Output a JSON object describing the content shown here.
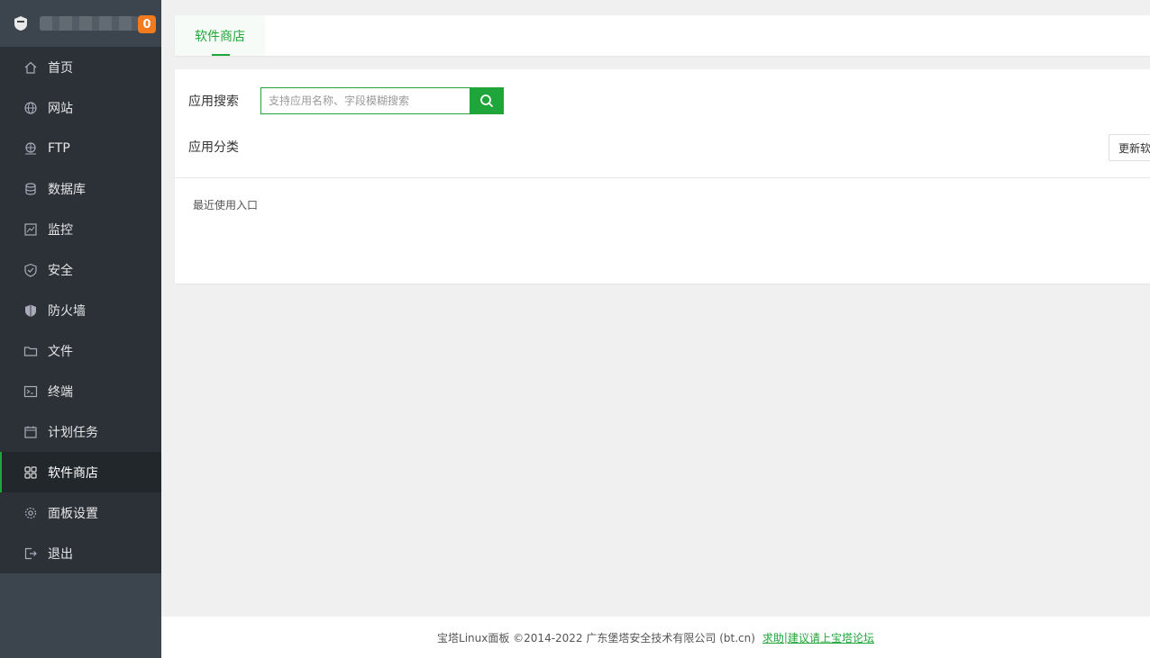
{
  "brand": {
    "badge_count": "0"
  },
  "sidebar": {
    "items": [
      {
        "label": "首页",
        "icon": "home-icon"
      },
      {
        "label": "网站",
        "icon": "globe-icon"
      },
      {
        "label": "FTP",
        "icon": "ftp-icon"
      },
      {
        "label": "数据库",
        "icon": "database-icon"
      },
      {
        "label": "监控",
        "icon": "monitor-icon"
      },
      {
        "label": "安全",
        "icon": "shield-check-icon"
      },
      {
        "label": "防火墙",
        "icon": "firewall-icon"
      },
      {
        "label": "文件",
        "icon": "folder-icon"
      },
      {
        "label": "终端",
        "icon": "terminal-icon"
      },
      {
        "label": "计划任务",
        "icon": "calendar-icon"
      },
      {
        "label": "软件商店",
        "icon": "grid-icon",
        "active": true
      },
      {
        "label": "面板设置",
        "icon": "gear-icon"
      },
      {
        "label": "退出",
        "icon": "logout-icon"
      }
    ]
  },
  "tabs": [
    {
      "label": "软件商店",
      "active": true
    }
  ],
  "search": {
    "label": "应用搜索",
    "placeholder": "支持应用名称、字段模糊搜索"
  },
  "category": {
    "label": "应用分类",
    "update_button": "更新软"
  },
  "recent": {
    "label": "最近使用入口"
  },
  "footer": {
    "text": "宝塔Linux面板 ©2014-2022 广东堡塔安全技术有限公司 (bt.cn)",
    "link1": "求助",
    "sep": "|",
    "link2": "建议请上宝塔论坛"
  },
  "colors": {
    "accent": "#20a53a",
    "sidebar_bg": "#2c3138",
    "badge": "#f37b1d"
  }
}
